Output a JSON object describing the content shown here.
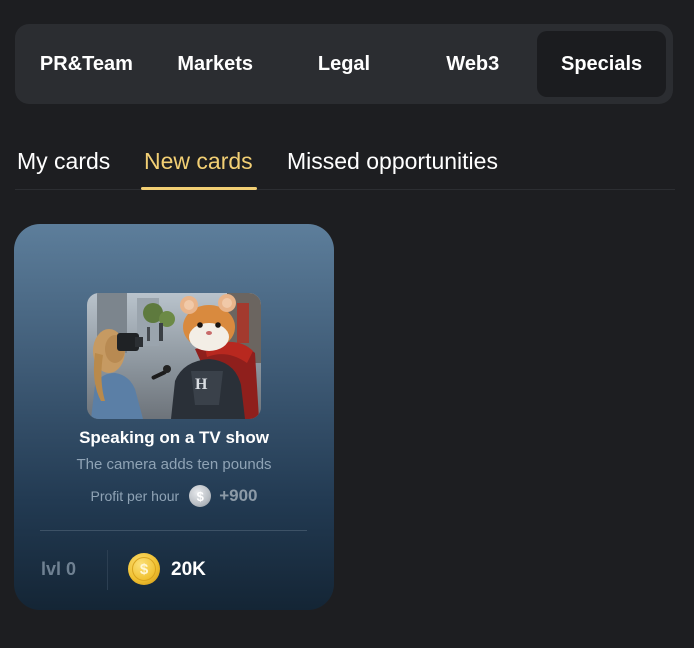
{
  "category_tabs": [
    {
      "label": "PR&Team",
      "active": false
    },
    {
      "label": "Markets",
      "active": false
    },
    {
      "label": "Legal",
      "active": false
    },
    {
      "label": "Web3",
      "active": false
    },
    {
      "label": "Specials",
      "active": true
    }
  ],
  "sub_tabs": [
    {
      "label": "My cards",
      "active": false
    },
    {
      "label": "New cards",
      "active": true
    },
    {
      "label": "Missed opportunities",
      "active": false
    }
  ],
  "card": {
    "image_icon": "hamster-reporter-illustration",
    "title": "Speaking on a TV show",
    "description": "The camera adds ten pounds",
    "profit_label": "Profit per hour",
    "profit_coin_icon": "silver-coin-icon",
    "profit_value": "+900",
    "level": "lvl 0",
    "price_coin_icon": "gold-coin-icon",
    "price": "20K"
  },
  "colors": {
    "background": "#1d1e21",
    "tab_bar": "#2b2d31",
    "active_tab": "#1b1c1f",
    "accent": "#f2cf74",
    "card_top": "#5d7e9b",
    "card_bottom": "#142535"
  }
}
